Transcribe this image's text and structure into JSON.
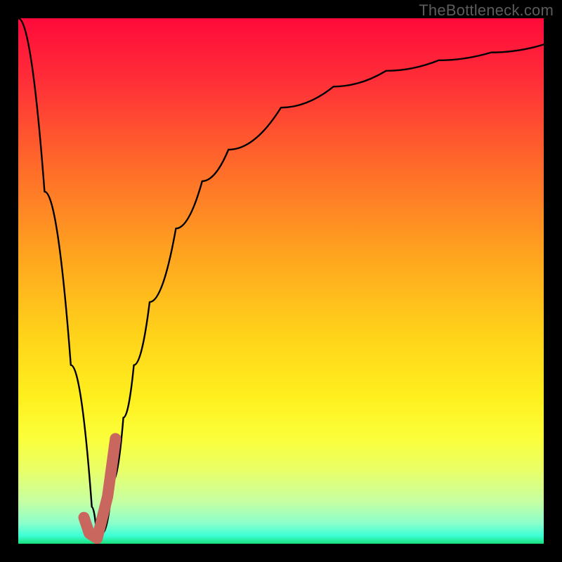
{
  "watermark": {
    "text": "TheBottleneck.com"
  },
  "colors": {
    "gradient_stops": [
      {
        "offset": 0.0,
        "color": "#ff0a3a"
      },
      {
        "offset": 0.12,
        "color": "#ff2f38"
      },
      {
        "offset": 0.28,
        "color": "#ff6a2a"
      },
      {
        "offset": 0.45,
        "color": "#ffa41f"
      },
      {
        "offset": 0.6,
        "color": "#ffd21a"
      },
      {
        "offset": 0.72,
        "color": "#ffef1e"
      },
      {
        "offset": 0.8,
        "color": "#fbff3b"
      },
      {
        "offset": 0.86,
        "color": "#e9ff68"
      },
      {
        "offset": 0.92,
        "color": "#c6ffa3"
      },
      {
        "offset": 0.96,
        "color": "#8dffca"
      },
      {
        "offset": 0.985,
        "color": "#3dffd6"
      },
      {
        "offset": 1.0,
        "color": "#18e07a"
      }
    ],
    "curve_color": "#000000",
    "highlight_color": "#c9675e",
    "background": "#000000"
  },
  "chart_data": {
    "type": "line",
    "title": "",
    "xlabel": "",
    "ylabel": "",
    "xlim": [
      0,
      100
    ],
    "ylim": [
      0,
      100
    ],
    "series": [
      {
        "name": "bottleneck-curve",
        "x": [
          0,
          5,
          10,
          14,
          15,
          16,
          18,
          20,
          22,
          25,
          30,
          35,
          40,
          50,
          60,
          70,
          80,
          90,
          100
        ],
        "y": [
          100,
          67,
          34,
          7,
          1,
          2,
          12,
          24,
          34,
          46,
          60,
          69,
          75,
          83,
          87,
          90,
          92,
          93.5,
          95
        ]
      },
      {
        "name": "highlight-segment",
        "x": [
          12.5,
          13.5,
          15,
          17,
          18.5
        ],
        "y": [
          5,
          2,
          1,
          9,
          20
        ]
      }
    ],
    "minimum": {
      "x": 15,
      "y": 1
    }
  }
}
